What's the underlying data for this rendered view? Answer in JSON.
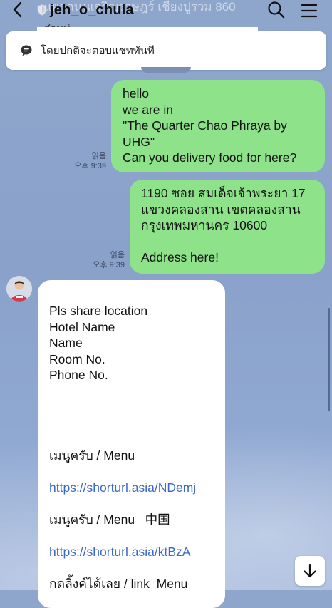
{
  "header": {
    "title": "jeh_o_chula",
    "peek_text": "แยกถนนเจริญราษฎร์ เชียงปูรวม 860",
    "peek_text2": "จำหน่"
  },
  "notice": {
    "text": "โดยปกติจะตอบแชททันที"
  },
  "messages": {
    "out1": {
      "text": "hello\nwe are in\n\"The Quarter Chao Phraya by\nUHG\"\nCan you delivery food for here?",
      "read": "읽음",
      "time": "오후 9:39"
    },
    "out2": {
      "text": "1190 ซอย สมเด็จเจ้าพระยา 17\nแขวงคลองสาน เขตคลองสาน\nกรุงเทพมหานคร 10600\n\nAddress here!",
      "read": "읽음",
      "time": "오후 9:39"
    },
    "in1": {
      "lines": [
        "Pls share location",
        "Hotel Name",
        "Name",
        "Room No.",
        "Phone No."
      ],
      "menu1_label": "เมนูครับ / Menu",
      "menu1_link": "https://shorturl.asia/NDemj",
      "menu2_label": "เมนูครับ / Menu   中国",
      "menu2_link": "https://shorturl.asia/ktBzA",
      "footer_line": "กดลิ้งค์ได้เลย / link  Menu"
    }
  },
  "colors": {
    "outgoing_bubble": "#8de28a",
    "incoming_bubble": "#ffffff",
    "link": "#3a68c8",
    "background": "#8fa6cc"
  },
  "icons": [
    "back-icon",
    "shield-icon",
    "search-icon",
    "menu-icon",
    "chat-bubble-icon",
    "scroll-down-icon"
  ]
}
